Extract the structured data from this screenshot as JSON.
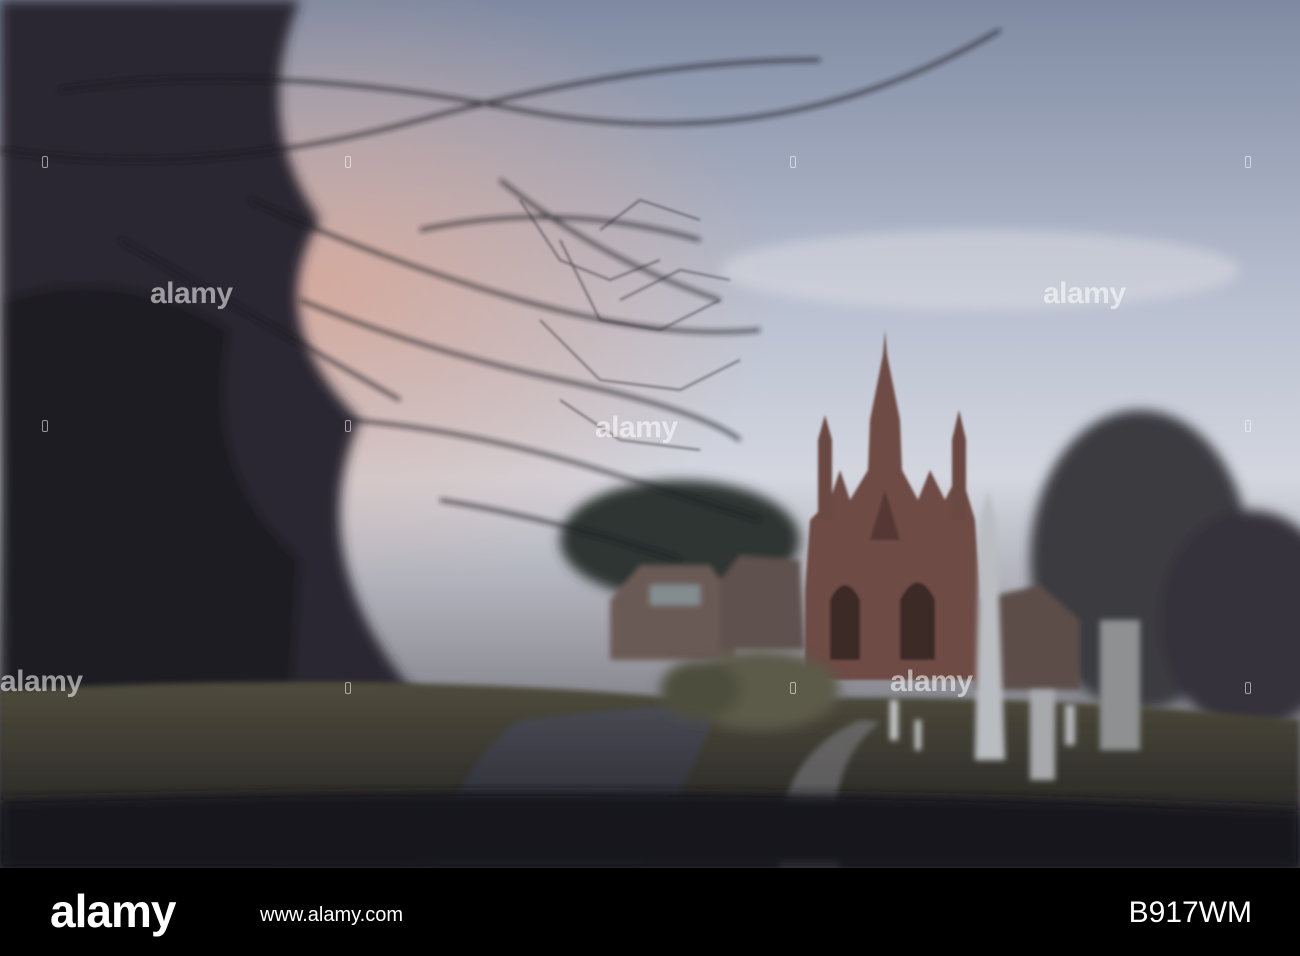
{
  "watermark": {
    "text": "alamy"
  },
  "footer": {
    "brand": "alamy",
    "url": "www.alamy.com",
    "image_id": "B917WM"
  },
  "colors": {
    "sky_top": "#8a93a8",
    "sky_mid": "#c9cfdc",
    "sunset_glow": "#c89a8c",
    "gate_stone": "#6e4b45",
    "ground": "#4b4a3a",
    "road": "#3a3b45",
    "bar": "#000000"
  }
}
